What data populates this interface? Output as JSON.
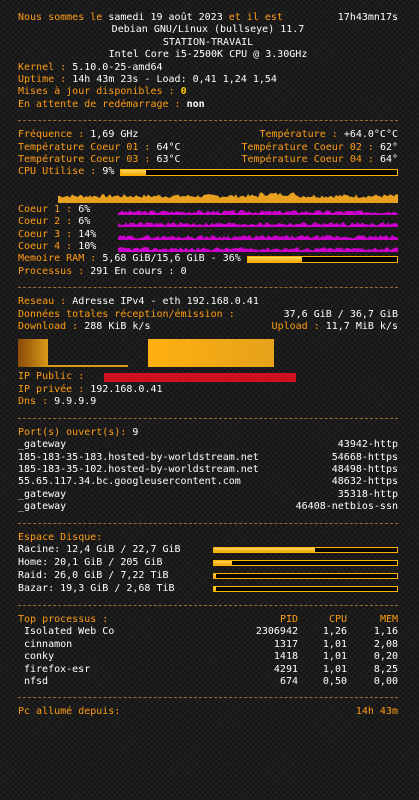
{
  "header": {
    "lead": "Nous sommes le",
    "date": "samedi 19 août 2023",
    "mid": "et il est",
    "time": "17h43mn17s",
    "os": "Debian GNU/Linux (bullseye) 11.7",
    "host": "STATION-TRAVAIL",
    "cpu": "Intel Core i5-2500K CPU @ 3.30GHz"
  },
  "system": {
    "kernel_label": "Kernel :",
    "kernel_value": "5.10.0-25-amd64",
    "uptime_label": "Uptime :",
    "uptime_value": "14h 43m 23s - Load: 0,41 1,24 1,54",
    "updates_label": "Mises à jour disponibles :",
    "updates_value": "0",
    "reboot_label": "En attente de redémarrage :",
    "reboot_value": "non"
  },
  "cpu": {
    "freq_label": "Fréquence :",
    "freq_value": "1,69 GHz",
    "temp_label": "Température :",
    "temp_value": "+64.0°C°C",
    "core1_temp_label": "Température Coeur 01 :",
    "core1_temp_value": "64°C",
    "core2_temp_label": "Température Coeur 02 :",
    "core2_temp_value": "62°",
    "core3_temp_label": "Température Coeur 03 :",
    "core3_temp_value": "63°C",
    "core4_temp_label": "Température Coeur 04 :",
    "core4_temp_value": "64°",
    "usage_label": "CPU Utilise :",
    "usage_value": "9%",
    "usage_fraction": 0.09,
    "cores": [
      {
        "label": "Coeur 1 :",
        "value": "6%"
      },
      {
        "label": "Coeur 2 :",
        "value": "6%"
      },
      {
        "label": "Coeur 3 :",
        "value": "14%"
      },
      {
        "label": "Coeur 4 :",
        "value": "10%"
      }
    ],
    "ram_label": "Memoire RAM :",
    "ram_value": "5,68 GiB/15,6 GiB - 36%",
    "ram_fraction": 0.36,
    "proc_label": "Processus :",
    "proc_value": "291",
    "running_label": "En cours :",
    "running_value": "0"
  },
  "network": {
    "net_label": "Reseau :",
    "net_value": "Adresse IPv4 - eth 192.168.0.41",
    "totals_label": "Données totales réception/émission :",
    "totals_value": "37,6 GiB / 36,7 GiB",
    "down_label": "Download :",
    "down_value": "288 KiB k/s",
    "up_label": "Upload :",
    "up_value": "11,7 MiB k/s",
    "public_label": "IP Public :",
    "private_label": "IP privée :",
    "private_value": "192.168.0.41",
    "dns_label": "Dns :",
    "dns_value": "9.9.9.9"
  },
  "ports": {
    "label": "Port(s) ouvert(s):",
    "count": "9",
    "rows": [
      {
        "host": "_gateway",
        "port": "43942-http"
      },
      {
        "host": "185-183-35-183.hosted-by-worldstream.net",
        "port": "54668-https"
      },
      {
        "host": "185-183-35-102.hosted-by-worldstream.net",
        "port": "48498-https"
      },
      {
        "host": "55.65.117.34.bc.googleusercontent.com",
        "port": "48632-https"
      },
      {
        "host": "_gateway",
        "port": "35318-http"
      },
      {
        "host": "_gateway",
        "port": "46408-netbios-ssn"
      }
    ]
  },
  "disk": {
    "label": "Espace Disque:",
    "rows": [
      {
        "text": "Racine: 12,4 GiB / 22,7 GiB",
        "fraction": 0.55
      },
      {
        "text": "Home: 20,1 GiB / 205 GiB",
        "fraction": 0.1
      },
      {
        "text": "Raid: 26,0 GiB / 7,22 TiB",
        "fraction": 0.01
      },
      {
        "text": "Bazar: 19,3 GiB / 2,68 TiB",
        "fraction": 0.01
      }
    ]
  },
  "top": {
    "label": "Top processus :",
    "col_pid": "PID",
    "col_cpu": "CPU",
    "col_mem": "MEM",
    "rows": [
      {
        "name": "Isolated Web Co",
        "pid": "2306942",
        "cpu": "1,26",
        "mem": "1,16"
      },
      {
        "name": "cinnamon",
        "pid": "1317",
        "cpu": "1,01",
        "mem": "2,08"
      },
      {
        "name": "conky",
        "pid": "1418",
        "cpu": "1,01",
        "mem": "0,20"
      },
      {
        "name": "firefox-esr",
        "pid": "4291",
        "cpu": "1,01",
        "mem": "8,25"
      },
      {
        "name": "nfsd",
        "pid": "674",
        "cpu": "0,50",
        "mem": "0,00"
      }
    ]
  },
  "footer": {
    "label": "Pc allumé depuis:",
    "value": "14h 43m"
  },
  "colors": {
    "orange": "#ff9d14",
    "yellow": "#ffcc00",
    "magenta": "#cc00cc",
    "redaction": "#d01020"
  }
}
